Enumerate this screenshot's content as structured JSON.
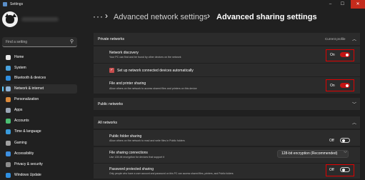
{
  "window": {
    "title": "Settings",
    "controls": {
      "minimize": "–",
      "maximize": "☐",
      "close": "✕"
    }
  },
  "sidebar": {
    "search": {
      "placeholder": "Find a setting"
    },
    "items": [
      {
        "label": "Home",
        "icon": "home-icon",
        "color": "#e8e8e8",
        "selected": false
      },
      {
        "label": "System",
        "icon": "system-icon",
        "color": "#4aa3df",
        "selected": false
      },
      {
        "label": "Bluetooth & devices",
        "icon": "bluetooth-icon",
        "color": "#2f8fe0",
        "selected": false
      },
      {
        "label": "Network & internet",
        "icon": "network-icon",
        "color": "#8fb3d6",
        "selected": true
      },
      {
        "label": "Personalization",
        "icon": "personalization-icon",
        "color": "#d9893b",
        "selected": false
      },
      {
        "label": "Apps",
        "icon": "apps-icon",
        "color": "#9aa6b5",
        "selected": false
      },
      {
        "label": "Accounts",
        "icon": "accounts-icon",
        "color": "#4bbf73",
        "selected": false
      },
      {
        "label": "Time & language",
        "icon": "time-language-icon",
        "color": "#3a9bdc",
        "selected": false
      },
      {
        "label": "Gaming",
        "icon": "gaming-icon",
        "color": "#a0a0a0",
        "selected": false
      },
      {
        "label": "Accessibility",
        "icon": "accessibility-icon",
        "color": "#3d8fe0",
        "selected": false
      },
      {
        "label": "Privacy & security",
        "icon": "privacy-icon",
        "color": "#8c8c8c",
        "selected": false
      },
      {
        "label": "Windows Update",
        "icon": "windows-update-icon",
        "color": "#2f8fe0",
        "selected": false
      }
    ]
  },
  "breadcrumb": {
    "more": "···",
    "separator": "›",
    "parent": "Advanced network settings",
    "current": "Advanced sharing settings"
  },
  "private_networks": {
    "label": "Private networks",
    "badge": "Current profile",
    "network_discovery": {
      "title": "Network discovery",
      "desc": "Your PC can find and be found by other devices on the network",
      "state": "On"
    },
    "auto_setup": {
      "label": "Set up network connected devices automatically",
      "checked": true
    },
    "file_printer_sharing": {
      "title": "File and printer sharing",
      "desc": "Allow others on the network to access shared files and printers on this device",
      "state": "On"
    }
  },
  "public_networks": {
    "label": "Public networks"
  },
  "all_networks": {
    "label": "All networks",
    "public_folder_sharing": {
      "title": "Public folder sharing",
      "desc": "Allow others on the network to read and write files in Public folders",
      "state": "Off"
    },
    "file_sharing_connections": {
      "title": "File sharing connections",
      "desc": "Use 128-bit encryption for devices that support it",
      "value": "128-bit encryption (Recommended)"
    },
    "password_protected_sharing": {
      "title": "Password protected sharing",
      "desc": "Only people who have a user account and password on this PC can access shared files, printers, and Public folders",
      "state": "Off"
    }
  },
  "colors": {
    "accent": "#c41414",
    "highlight": "#e00000",
    "background": "#202020",
    "card": "#2b2b2b"
  }
}
